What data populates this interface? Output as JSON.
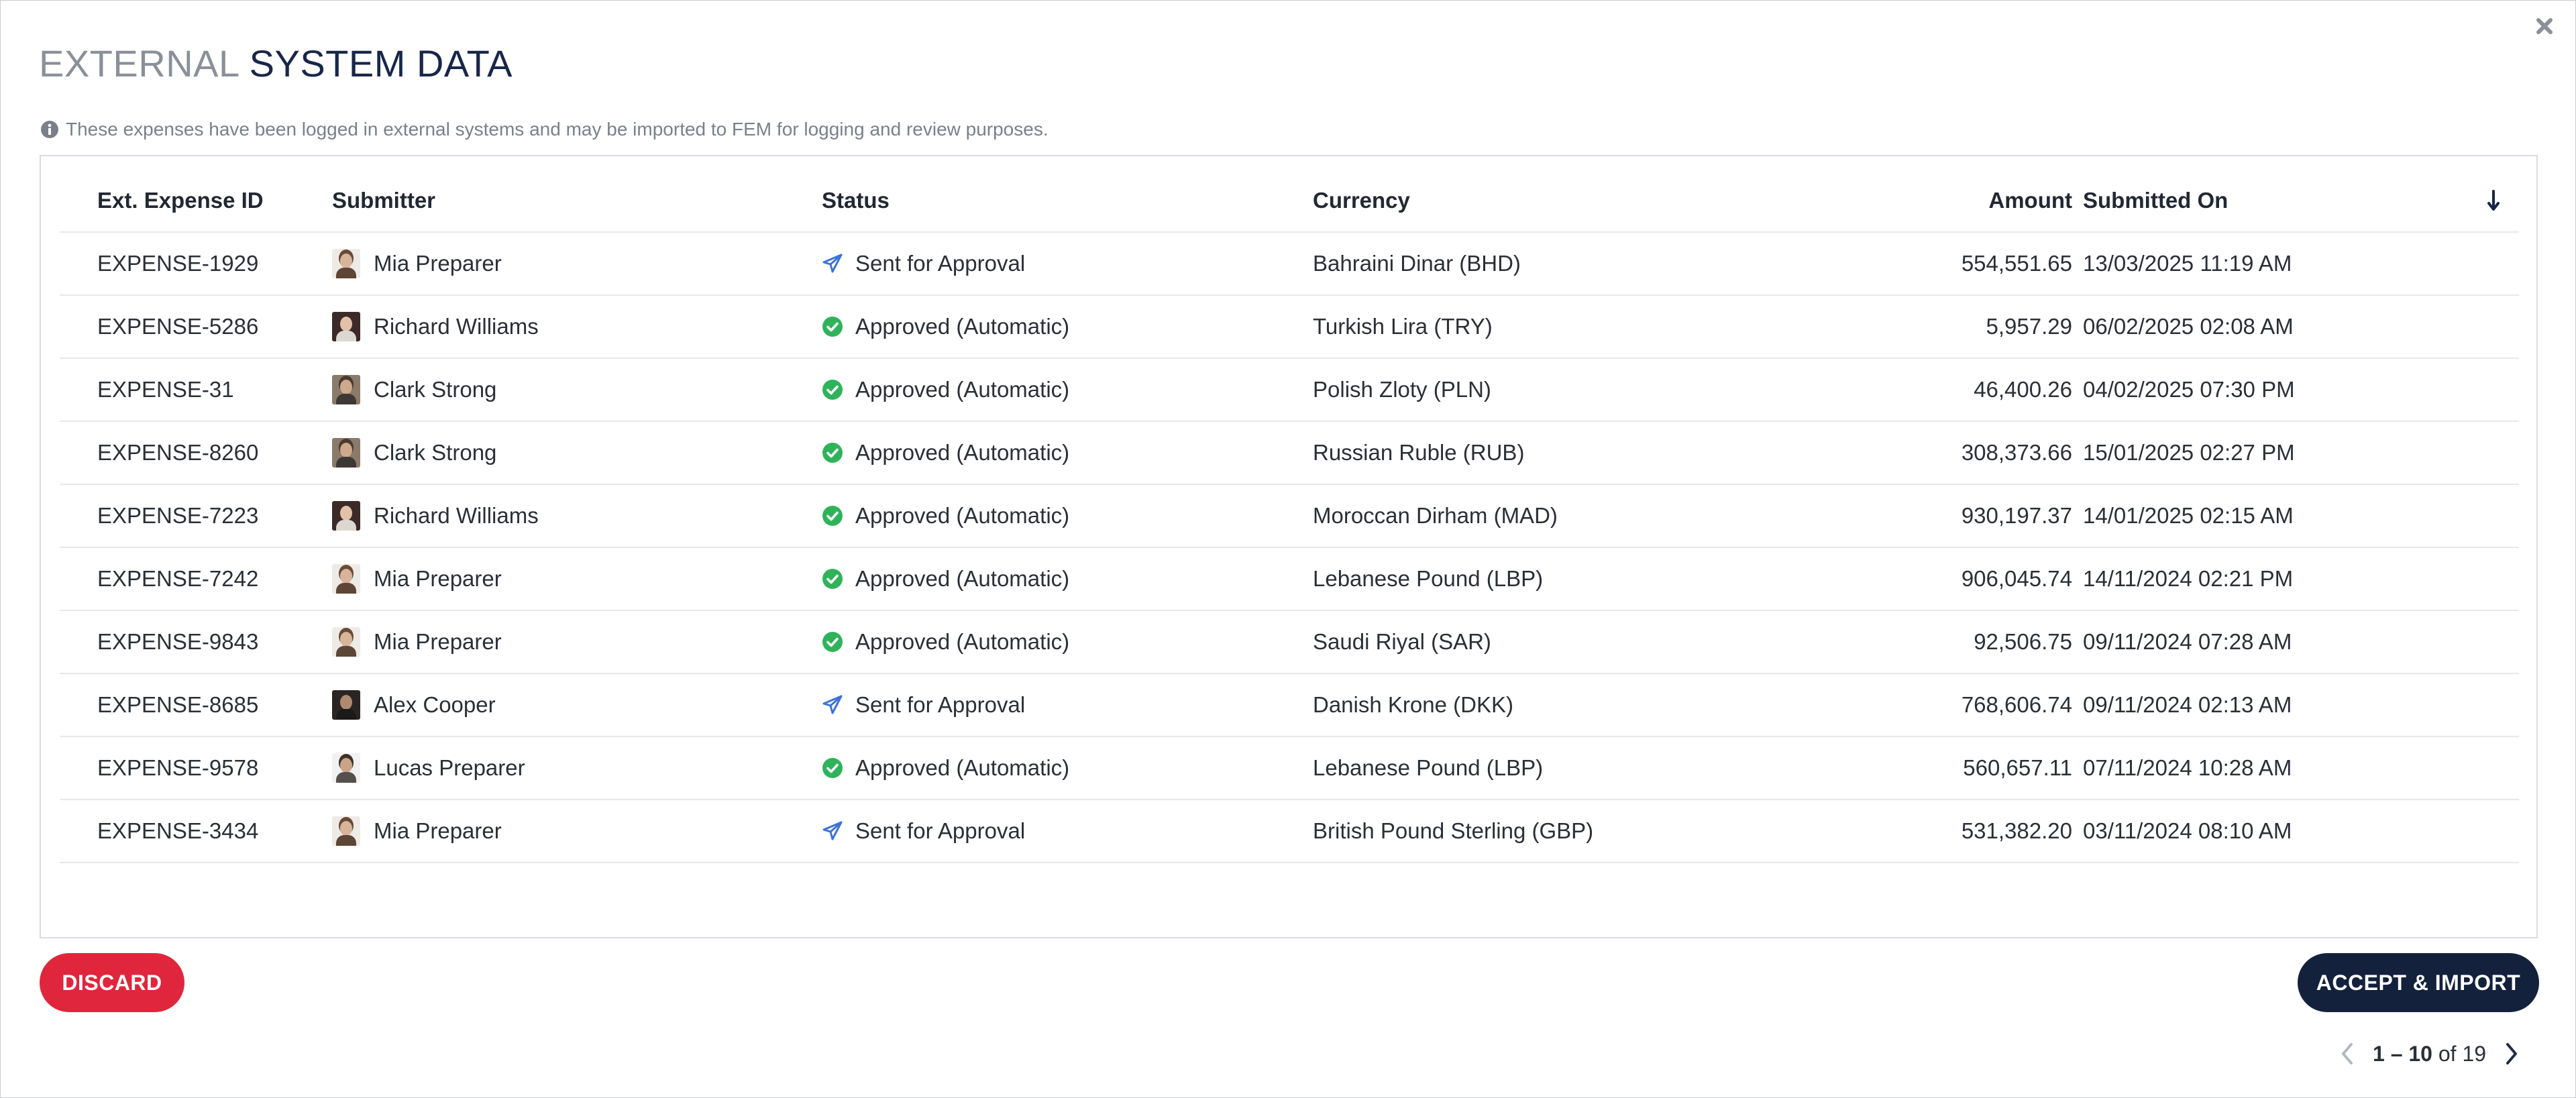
{
  "title": {
    "part1": "EXTERNAL",
    "part2": "SYSTEM DATA"
  },
  "info_text": "These expenses have been logged in external systems and may be imported to FEM for logging and review purposes.",
  "table": {
    "columns": [
      "Ext. Expense ID",
      "Submitter",
      "Status",
      "Currency",
      "Amount",
      "Submitted On"
    ],
    "sort_icon": "arrow-down-icon",
    "rows": [
      {
        "id": "EXPENSE-1929",
        "submitter": "Mia Preparer",
        "avatar": "mia",
        "status": "Sent for Approval",
        "status_icon": "paper-plane-icon",
        "currency": "Bahraini Dinar (BHD)",
        "amount": "554,551.65",
        "submitted_on": "13/03/2025 11:19 AM"
      },
      {
        "id": "EXPENSE-5286",
        "submitter": "Richard Williams",
        "avatar": "richard",
        "status": "Approved (Automatic)",
        "status_icon": "check-circle-icon",
        "currency": "Turkish Lira (TRY)",
        "amount": "5,957.29",
        "submitted_on": "06/02/2025 02:08 AM"
      },
      {
        "id": "EXPENSE-31",
        "submitter": "Clark Strong",
        "avatar": "clark",
        "status": "Approved (Automatic)",
        "status_icon": "check-circle-icon",
        "currency": "Polish Zloty (PLN)",
        "amount": "46,400.26",
        "submitted_on": "04/02/2025 07:30 PM"
      },
      {
        "id": "EXPENSE-8260",
        "submitter": "Clark Strong",
        "avatar": "clark",
        "status": "Approved (Automatic)",
        "status_icon": "check-circle-icon",
        "currency": "Russian Ruble (RUB)",
        "amount": "308,373.66",
        "submitted_on": "15/01/2025 02:27 PM"
      },
      {
        "id": "EXPENSE-7223",
        "submitter": "Richard Williams",
        "avatar": "richard",
        "status": "Approved (Automatic)",
        "status_icon": "check-circle-icon",
        "currency": "Moroccan Dirham (MAD)",
        "amount": "930,197.37",
        "submitted_on": "14/01/2025 02:15 AM"
      },
      {
        "id": "EXPENSE-7242",
        "submitter": "Mia Preparer",
        "avatar": "mia",
        "status": "Approved (Automatic)",
        "status_icon": "check-circle-icon",
        "currency": "Lebanese Pound (LBP)",
        "amount": "906,045.74",
        "submitted_on": "14/11/2024 02:21 PM"
      },
      {
        "id": "EXPENSE-9843",
        "submitter": "Mia Preparer",
        "avatar": "mia",
        "status": "Approved (Automatic)",
        "status_icon": "check-circle-icon",
        "currency": "Saudi Riyal (SAR)",
        "amount": "92,506.75",
        "submitted_on": "09/11/2024 07:28 AM"
      },
      {
        "id": "EXPENSE-8685",
        "submitter": "Alex Cooper",
        "avatar": "alex",
        "status": "Sent for Approval",
        "status_icon": "paper-plane-icon",
        "currency": "Danish Krone (DKK)",
        "amount": "768,606.74",
        "submitted_on": "09/11/2024 02:13 AM"
      },
      {
        "id": "EXPENSE-9578",
        "submitter": "Lucas Preparer",
        "avatar": "lucas",
        "status": "Approved (Automatic)",
        "status_icon": "check-circle-icon",
        "currency": "Lebanese Pound (LBP)",
        "amount": "560,657.11",
        "submitted_on": "07/11/2024 10:28 AM"
      },
      {
        "id": "EXPENSE-3434",
        "submitter": "Mia Preparer",
        "avatar": "mia",
        "status": "Sent for Approval",
        "status_icon": "paper-plane-icon",
        "currency": "British Pound Sterling (GBP)",
        "amount": "531,382.20",
        "submitted_on": "03/11/2024 08:10 AM"
      }
    ]
  },
  "pagination": {
    "range": "1 – 10",
    "of_label": "of",
    "total": "19"
  },
  "buttons": {
    "discard": "DISCARD",
    "accept": "ACCEPT & IMPORT"
  },
  "colors": {
    "navy": "#14213d",
    "danger": "#e0263c",
    "approved_green": "#2fb35a",
    "sent_blue": "#3b73d9",
    "muted_text": "#7a808a"
  }
}
